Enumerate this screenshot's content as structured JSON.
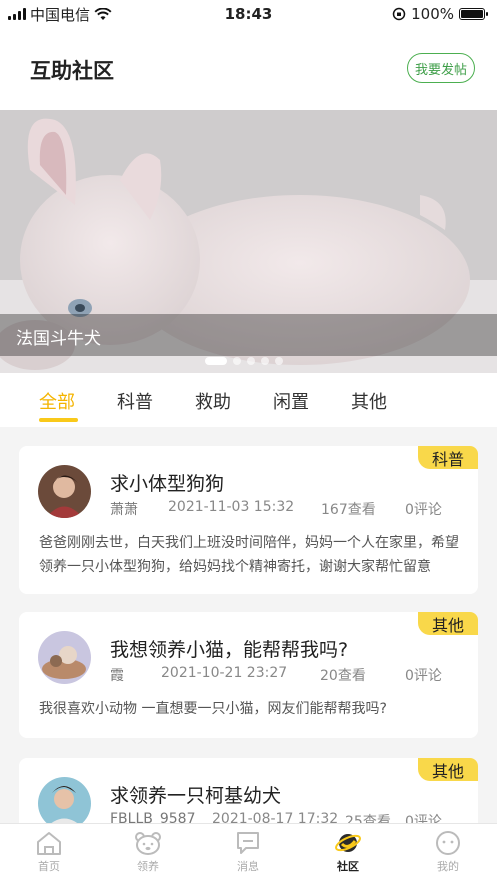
{
  "status_bar": {
    "carrier": "中国电信",
    "time": "18:43",
    "battery": "100%"
  },
  "header": {
    "title": "互助社区",
    "post_button": "我要发帖"
  },
  "banner": {
    "caption": "法国斗牛犬",
    "slide_count": 5,
    "active_slide": 1
  },
  "tabs": [
    {
      "label": "全部",
      "active": true
    },
    {
      "label": "科普",
      "active": false
    },
    {
      "label": "救助",
      "active": false
    },
    {
      "label": "闲置",
      "active": false
    },
    {
      "label": "其他",
      "active": false
    }
  ],
  "posts": [
    {
      "tag": "科普",
      "title": "求小体型狗狗",
      "author": "萧萧",
      "datetime": "2021-11-03 15:32",
      "views": "167查看",
      "comments": "0评论",
      "content": "爸爸刚刚去世，白天我们上班没时间陪伴，妈妈一个人在家里，希望领养一只小体型狗狗，给妈妈找个精神寄托，谢谢大家帮忙留意"
    },
    {
      "tag": "其他",
      "title": "我想领养小猫，能帮帮我吗?",
      "author": "霞",
      "datetime": "2021-10-21 23:27",
      "views": "20查看",
      "comments": "0评论",
      "content": "我很喜欢小动物 一直想要一只小猫，网友们能帮帮我吗?"
    },
    {
      "tag": "其他",
      "title": "求领养一只柯基幼犬",
      "author": "FBLLB_9587",
      "datetime": "2021-08-17 17:32",
      "views": "25查看",
      "comments": "0评论",
      "content": ""
    }
  ],
  "tabbar": [
    {
      "label": "首页",
      "icon": "home-icon",
      "active": false
    },
    {
      "label": "领养",
      "icon": "bear-icon",
      "active": false
    },
    {
      "label": "消息",
      "icon": "message-icon",
      "active": false
    },
    {
      "label": "社区",
      "icon": "planet-icon",
      "active": true
    },
    {
      "label": "我的",
      "icon": "profile-icon",
      "active": false
    }
  ],
  "colors": {
    "accent": "#f9c91a",
    "tag_bg": "#f9d84a",
    "post_button": "#4caf50"
  }
}
